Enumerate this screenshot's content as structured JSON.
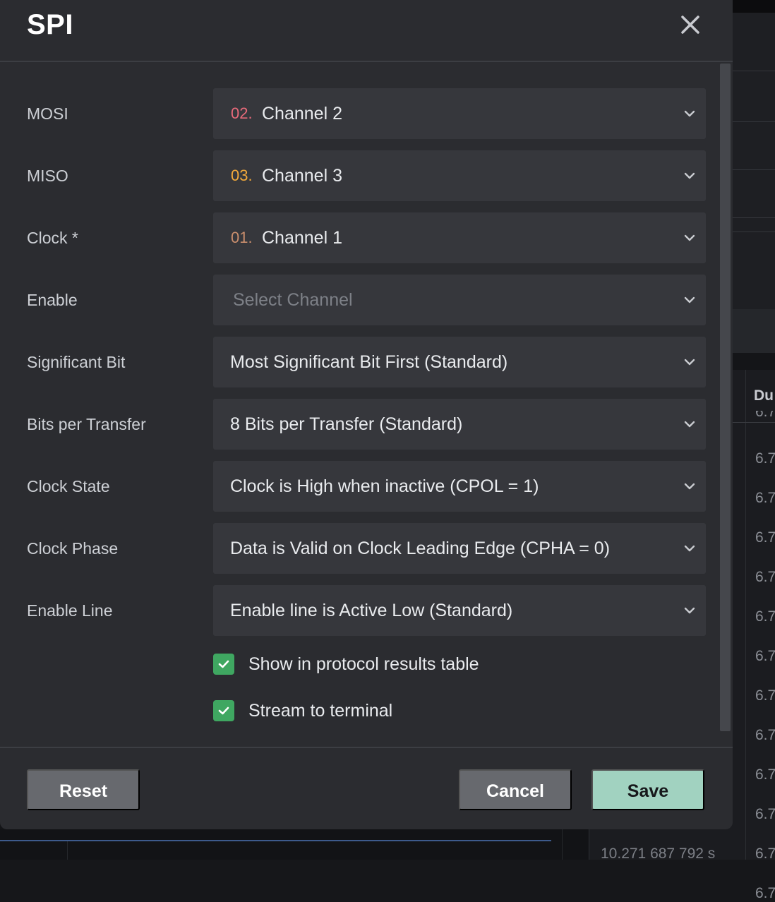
{
  "background": {
    "table_header": "Du",
    "table_cells": [
      "6.7",
      "6.7",
      "6.7",
      "6.7",
      "6.7",
      "6.7",
      "6.7",
      "6.7",
      "6.7",
      "6.7",
      "6.7",
      "6.7"
    ],
    "partial_cell_top": "6.7",
    "timestamp": "10.271 687 792 s"
  },
  "dialog": {
    "title": "SPI",
    "close_icon": "close-icon",
    "fields": [
      {
        "label": "MOSI",
        "num": "02.",
        "num_color": "#e86a7a",
        "value": "Channel 2"
      },
      {
        "label": "MISO",
        "num": "03.",
        "num_color": "#f2a93b",
        "value": "Channel 3"
      },
      {
        "label": "Clock *",
        "num": "01.",
        "num_color": "#c98e6d",
        "value": "Channel 1"
      },
      {
        "label": "Enable",
        "placeholder": "Select Channel"
      },
      {
        "label": "Significant Bit",
        "value": "Most Significant Bit First (Standard)"
      },
      {
        "label": "Bits per Transfer",
        "value": "8 Bits per Transfer (Standard)"
      },
      {
        "label": "Clock State",
        "value": "Clock is High when inactive (CPOL = 1)"
      },
      {
        "label": "Clock Phase",
        "value": "Data is Valid on Clock Leading Edge (CPHA = 0)"
      },
      {
        "label": "Enable Line",
        "value": "Enable line is Active Low (Standard)"
      }
    ],
    "checkboxes": [
      {
        "label": "Show in protocol results table",
        "checked": true
      },
      {
        "label": "Stream to terminal",
        "checked": true
      }
    ],
    "buttons": {
      "reset": "Reset",
      "cancel": "Cancel",
      "save": "Save"
    },
    "colors": {
      "accent_check": "#3fa761",
      "save_button": "#a1d2c0"
    }
  }
}
